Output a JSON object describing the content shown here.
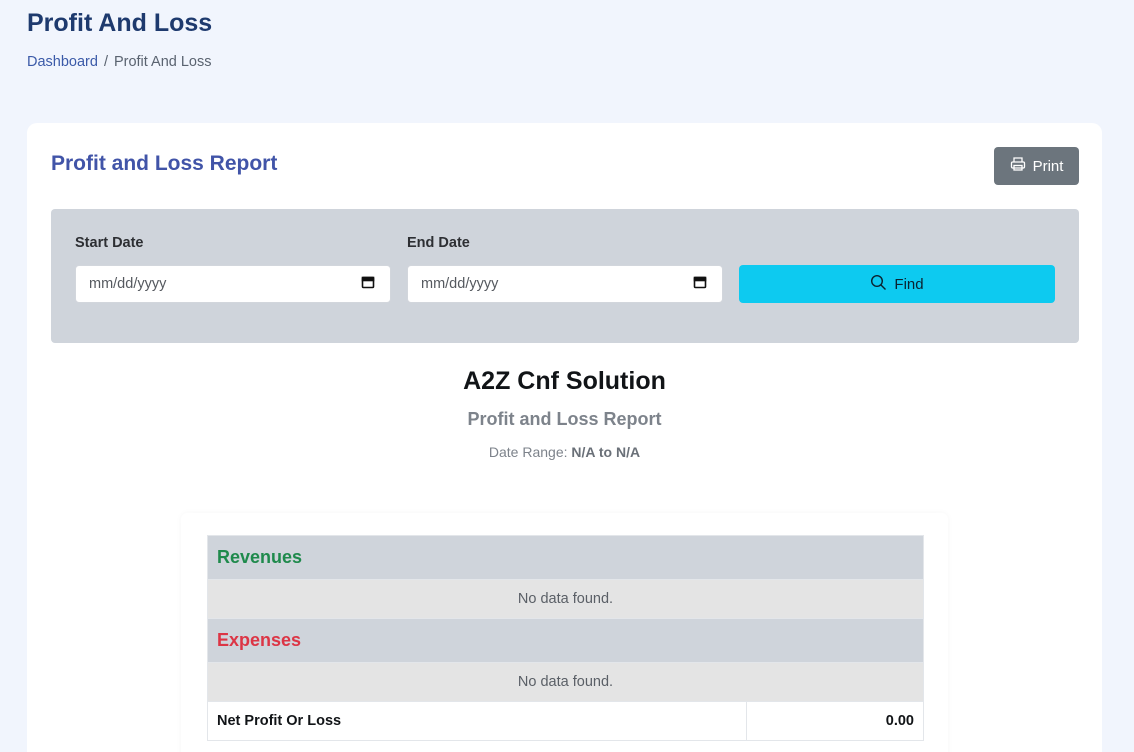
{
  "header": {
    "title": "Profit And Loss",
    "breadcrumb": {
      "home": "Dashboard",
      "separator": "/",
      "current": "Profit And Loss"
    }
  },
  "card": {
    "title": "Profit and Loss Report",
    "print_label": "Print"
  },
  "filters": {
    "start_label": "Start Date",
    "start_placeholder": "mm/dd/yyyy",
    "end_label": "End Date",
    "end_placeholder": "mm/dd/yyyy",
    "find_label": "Find"
  },
  "report": {
    "company": "A2Z Cnf Solution",
    "subtitle": "Profit and Loss Report",
    "date_range_label": "Date Range:",
    "date_range_value": "N/A to N/A",
    "revenues_heading": "Revenues",
    "revenues_empty": "No data found.",
    "expenses_heading": "Expenses",
    "expenses_empty": "No data found.",
    "net_label": "Net Profit Or Loss",
    "net_value": "0.00"
  },
  "colors": {
    "background": "#f1f5fd",
    "title": "#1e3a6e",
    "card_title": "#4154a8",
    "print_button": "#6c757d",
    "find_button": "#0dcaf0",
    "revenue": "#1f8a4c",
    "expense": "#dc3545"
  },
  "icons": {
    "print": "printer-icon",
    "calendar": "calendar-icon",
    "find": "search-icon"
  }
}
